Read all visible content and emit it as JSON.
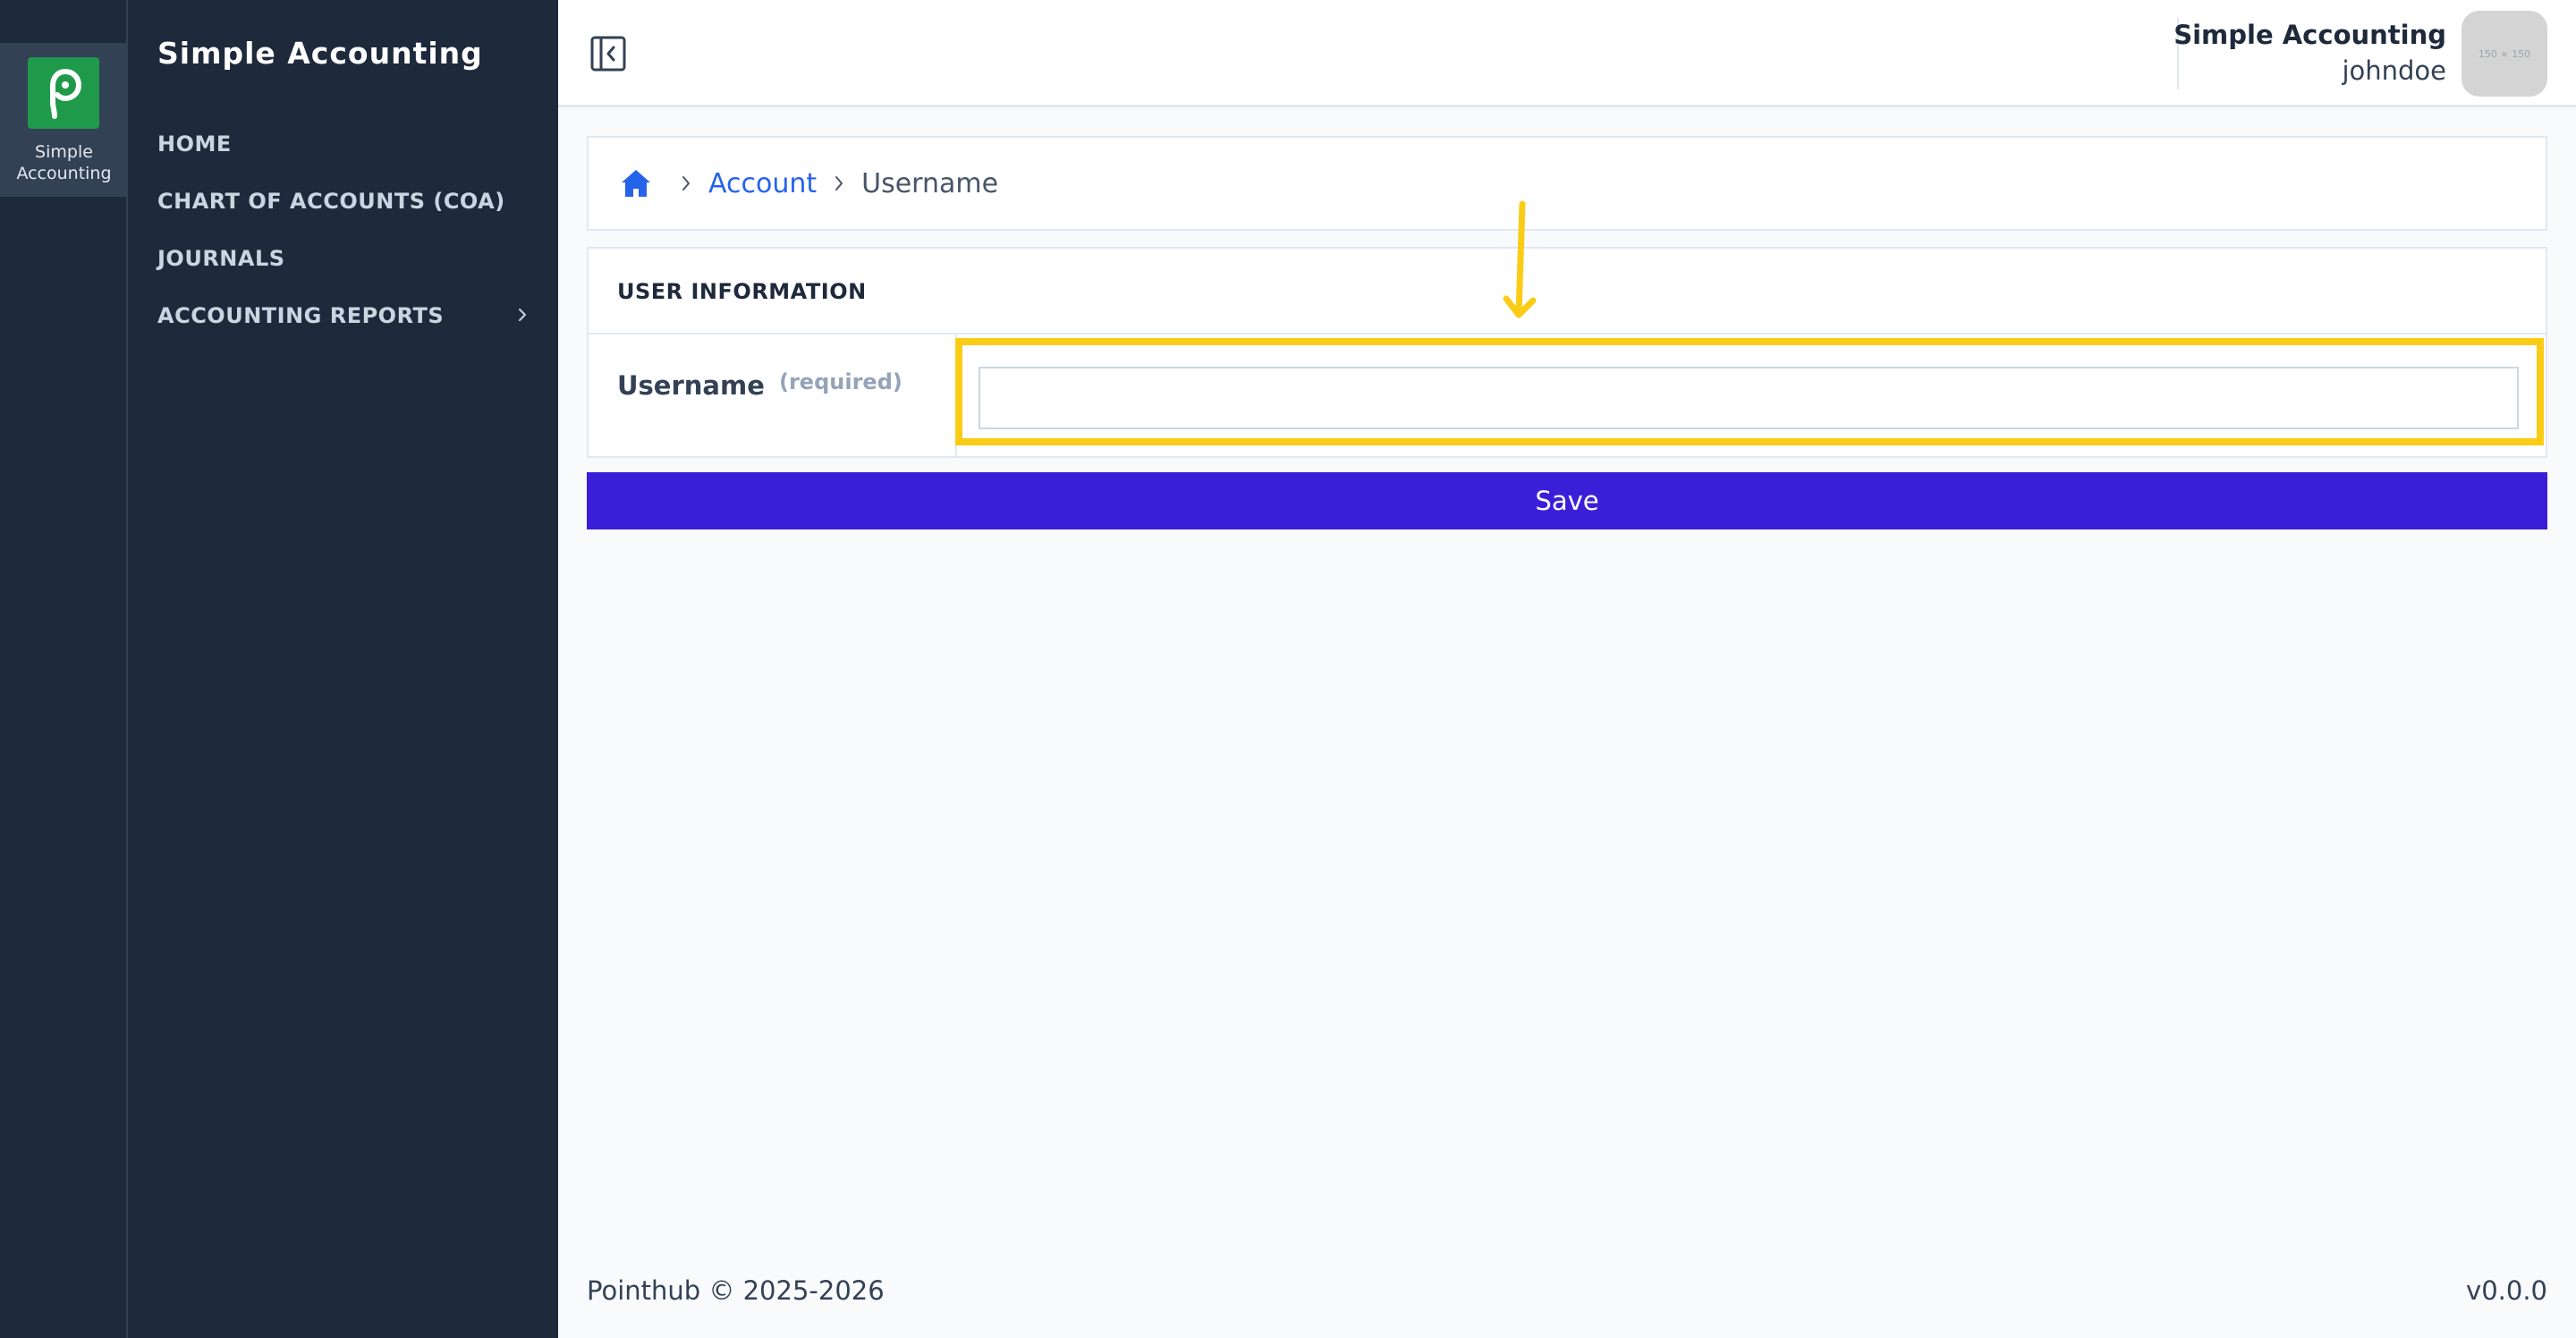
{
  "rail": {
    "app_label_line1": "Simple",
    "app_label_line2": "Accounting"
  },
  "sidebar": {
    "title": "Simple Accounting",
    "items": [
      {
        "label": "HOME"
      },
      {
        "label": "CHART OF ACCOUNTS (COA)"
      },
      {
        "label": "JOURNALS"
      },
      {
        "label": "ACCOUNTING REPORTS",
        "has_submenu": true
      }
    ]
  },
  "topbar": {
    "app_name": "Simple Accounting",
    "username": "johndoe",
    "avatar_placeholder": "150 × 150"
  },
  "breadcrumb": {
    "items": [
      {
        "label": "Account",
        "link": true
      },
      {
        "label": "Username",
        "link": false
      }
    ]
  },
  "form": {
    "section_title": "USER INFORMATION",
    "field_label": "Username",
    "field_hint": "(required)",
    "field_value": "",
    "save_label": "Save"
  },
  "footer": {
    "copyright": "Pointhub © 2025-2026",
    "version": "v0.0.0"
  },
  "colors": {
    "sidebar_bg": "#1e293b",
    "logo_green": "#1f9a4b",
    "link_blue": "#2563eb",
    "save_button": "#3b1fd8",
    "annotation_yellow": "#facc15"
  }
}
